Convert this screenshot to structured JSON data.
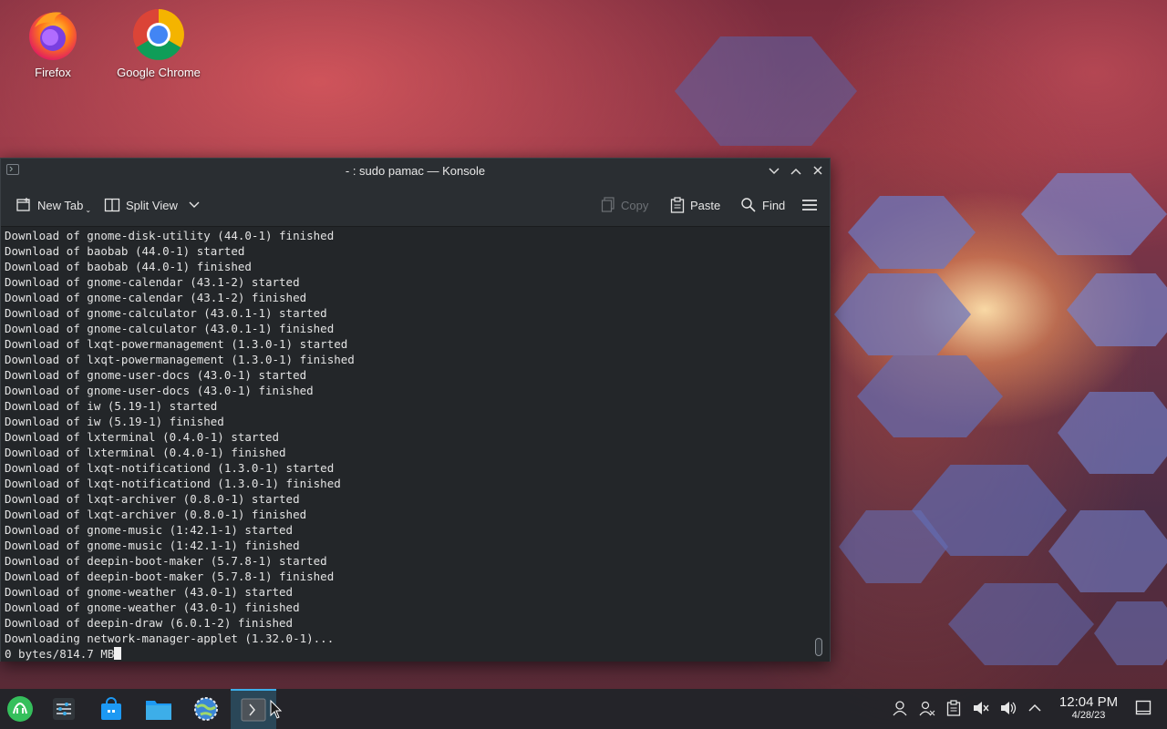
{
  "desktop": {
    "icons": [
      {
        "label": "Firefox",
        "icon": "firefox-icon"
      },
      {
        "label": "Google Chrome",
        "icon": "chrome-icon"
      }
    ]
  },
  "window": {
    "title": "- : sudo pamac — Konsole",
    "toolbar": {
      "new_tab": "New Tab",
      "split_view": "Split View",
      "copy": "Copy",
      "paste": "Paste",
      "find": "Find"
    },
    "terminal_lines": [
      "Download of gnome-disk-utility (44.0-1) finished",
      "Download of baobab (44.0-1) started",
      "Download of baobab (44.0-1) finished",
      "Download of gnome-calendar (43.1-2) started",
      "Download of gnome-calendar (43.1-2) finished",
      "Download of gnome-calculator (43.0.1-1) started",
      "Download of gnome-calculator (43.0.1-1) finished",
      "Download of lxqt-powermanagement (1.3.0-1) started",
      "Download of lxqt-powermanagement (1.3.0-1) finished",
      "Download of gnome-user-docs (43.0-1) started",
      "Download of gnome-user-docs (43.0-1) finished",
      "Download of iw (5.19-1) started",
      "Download of iw (5.19-1) finished",
      "Download of lxterminal (0.4.0-1) started",
      "Download of lxterminal (0.4.0-1) finished",
      "Download of lxqt-notificationd (1.3.0-1) started",
      "Download of lxqt-notificationd (1.3.0-1) finished",
      "Download of lxqt-archiver (0.8.0-1) started",
      "Download of lxqt-archiver (0.8.0-1) finished",
      "Download of gnome-music (1:42.1-1) started",
      "Download of gnome-music (1:42.1-1) finished",
      "Download of deepin-boot-maker (5.7.8-1) started",
      "Download of deepin-boot-maker (5.7.8-1) finished",
      "Download of gnome-weather (43.0-1) started",
      "Download of gnome-weather (43.0-1) finished",
      "Download of deepin-draw (6.0.1-2) finished",
      "Downloading network-manager-applet (1.32.0-1)...",
      "0 bytes/814.7 MB"
    ]
  },
  "taskbar": {
    "clock_time": "12:04 PM",
    "clock_date": "4/28/23"
  },
  "colors": {
    "terminal_bg": "#232629",
    "terminal_fg": "#e3e3e3",
    "accent": "#3daee9"
  }
}
